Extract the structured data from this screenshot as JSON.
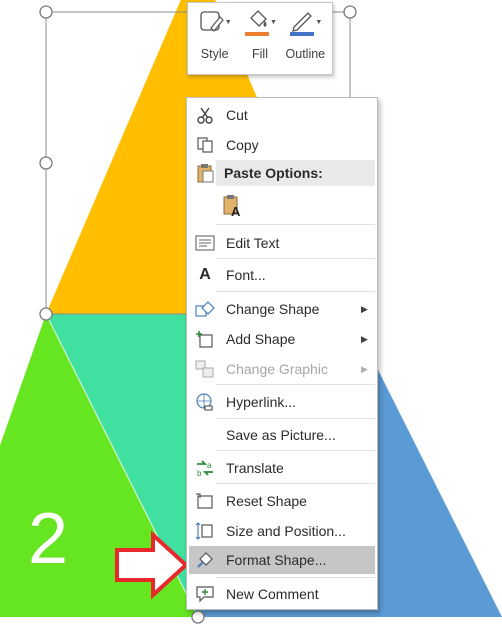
{
  "slide": {
    "label_two": "2",
    "colors": {
      "yellow": "#ffbf00",
      "teal": "#40e0a0",
      "green": "#66e620",
      "blue": "#5b9bd5"
    }
  },
  "mini_toolbar": {
    "style_label": "Style",
    "fill_label": "Fill",
    "outline_label": "Outline",
    "fill_color": "#ed7d31",
    "outline_color": "#4472c4"
  },
  "context_menu": {
    "items": [
      {
        "label": "Cut",
        "icon": "scissors-icon"
      },
      {
        "label": "Copy",
        "icon": "copy-icon"
      },
      {
        "label": "Paste Options:",
        "icon": "clipboard-icon"
      },
      {
        "label": "Edit Text",
        "icon": "edit-text-icon"
      },
      {
        "label": "Font...",
        "icon": "font-icon"
      },
      {
        "label": "Change Shape",
        "icon": "change-shape-icon"
      },
      {
        "label": "Add Shape",
        "icon": "add-shape-icon"
      },
      {
        "label": "Change Graphic",
        "icon": "change-graphic-icon",
        "disabled": true
      },
      {
        "label": "Hyperlink...",
        "icon": "hyperlink-icon"
      },
      {
        "label": "Save as Picture..."
      },
      {
        "label": "Translate",
        "icon": "translate-icon"
      },
      {
        "label": "Reset Shape",
        "icon": "reset-shape-icon"
      },
      {
        "label": "Size and Position...",
        "icon": "size-position-icon"
      },
      {
        "label": "Format Shape...",
        "icon": "format-shape-icon",
        "highlighted": true
      },
      {
        "label": "New Comment",
        "icon": "comment-icon"
      }
    ]
  },
  "annotation": {
    "arrow_color": "#e8282b"
  }
}
